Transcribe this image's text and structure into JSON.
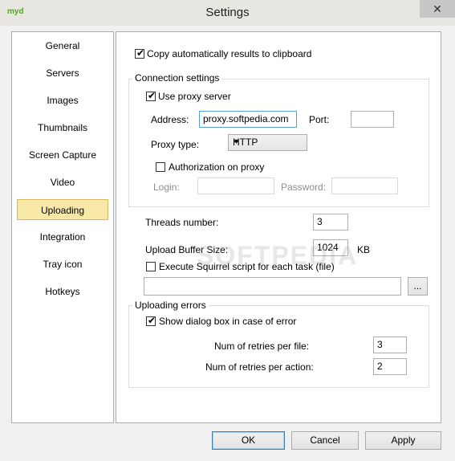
{
  "window": {
    "title": "Settings",
    "app_icon_text": "myd",
    "close_glyph": "✕"
  },
  "sidebar": {
    "items": [
      {
        "label": "General"
      },
      {
        "label": "Servers"
      },
      {
        "label": "Images"
      },
      {
        "label": "Thumbnails"
      },
      {
        "label": "Screen Capture"
      },
      {
        "label": "Video"
      },
      {
        "label": "Uploading",
        "selected": true
      },
      {
        "label": "Integration"
      },
      {
        "label": "Tray icon"
      },
      {
        "label": "Hotkeys"
      }
    ]
  },
  "uploading": {
    "copy_clipboard": {
      "label": "Copy automatically results to clipboard",
      "checked": true
    },
    "connection": {
      "title": "Connection settings",
      "use_proxy": {
        "label": "Use proxy server",
        "checked": true
      },
      "address_label": "Address:",
      "address_value": "proxy.softpedia.com",
      "port_label": "Port:",
      "port_value": "",
      "proxy_type_label": "Proxy type:",
      "proxy_type_value": "HTTP",
      "auth": {
        "label": "Authorization on proxy",
        "checked": false
      },
      "login_label": "Login:",
      "login_value": "",
      "password_label": "Password:",
      "password_value": ""
    },
    "threads_label": "Threads number:",
    "threads_value": "3",
    "buffer_label": "Upload Buffer Size:",
    "buffer_value": "1024",
    "buffer_unit": "KB",
    "squirrel": {
      "label": "Execute Squirrel script for each task (file)",
      "checked": false
    },
    "script_path": "",
    "browse_label": "...",
    "errors": {
      "title": "Uploading errors",
      "show_dialog": {
        "label": "Show dialog box in case of error",
        "checked": true
      },
      "retries_file_label": "Num of retries per file:",
      "retries_file_value": "3",
      "retries_action_label": "Num of retries per action:",
      "retries_action_value": "2"
    }
  },
  "footer": {
    "ok": "OK",
    "cancel": "Cancel",
    "apply": "Apply"
  },
  "watermark": "SOFTPEDIA",
  "check_glyph": "✔"
}
